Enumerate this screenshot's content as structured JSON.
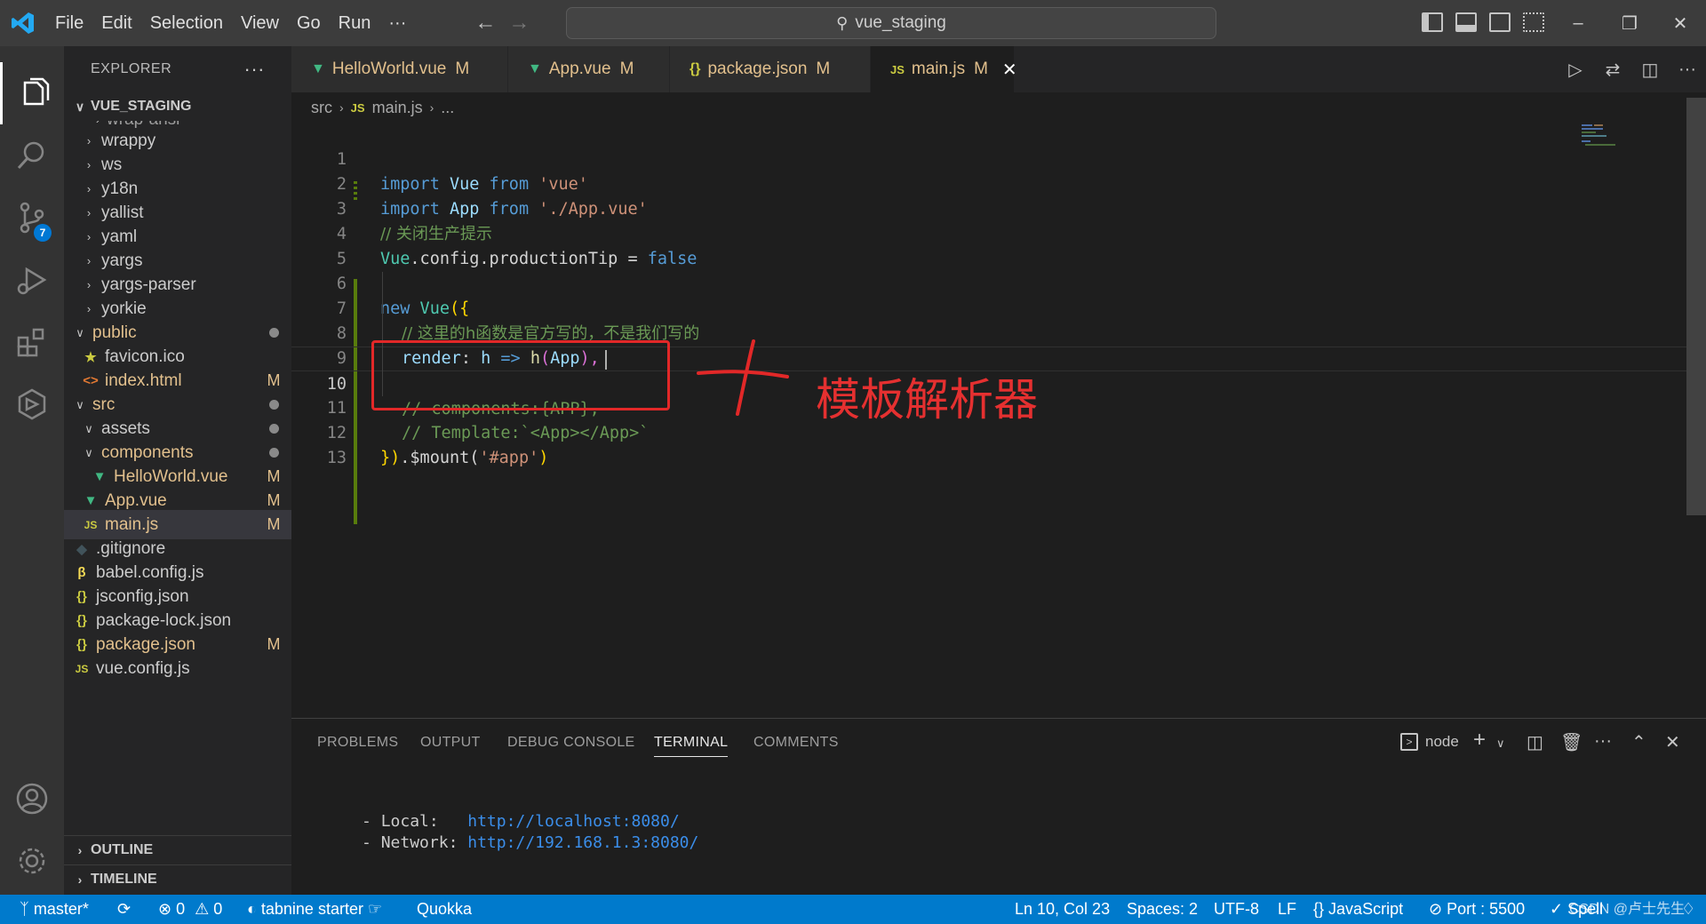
{
  "titlebar": {
    "menu": [
      "File",
      "Edit",
      "Selection",
      "View",
      "Go",
      "Run",
      "···"
    ],
    "search_text": "vue_staging"
  },
  "activity": {
    "scm_badge": "7"
  },
  "explorer": {
    "title": "EXPLORER",
    "more": "···",
    "root": "VUE_STAGING",
    "partial_item": "wrap-ansi",
    "items": [
      {
        "name": "wrappy",
        "kind": "folder"
      },
      {
        "name": "ws",
        "kind": "folder"
      },
      {
        "name": "y18n",
        "kind": "folder"
      },
      {
        "name": "yallist",
        "kind": "folder"
      },
      {
        "name": "yaml",
        "kind": "folder"
      },
      {
        "name": "yargs",
        "kind": "folder"
      },
      {
        "name": "yargs-parser",
        "kind": "folder"
      },
      {
        "name": "yorkie",
        "kind": "folder"
      },
      {
        "name": "public",
        "kind": "folder-open"
      },
      {
        "name": "favicon.ico",
        "kind": "file"
      },
      {
        "name": "index.html",
        "kind": "file",
        "status": "M"
      },
      {
        "name": "src",
        "kind": "folder-open"
      },
      {
        "name": "assets",
        "kind": "folder-open"
      },
      {
        "name": "components",
        "kind": "folder-open"
      },
      {
        "name": "HelloWorld.vue",
        "kind": "file",
        "status": "M"
      },
      {
        "name": "App.vue",
        "kind": "file",
        "status": "M"
      },
      {
        "name": "main.js",
        "kind": "file",
        "status": "M"
      },
      {
        "name": ".gitignore",
        "kind": "file"
      },
      {
        "name": "babel.config.js",
        "kind": "file"
      },
      {
        "name": "jsconfig.json",
        "kind": "file"
      },
      {
        "name": "package-lock.json",
        "kind": "file"
      },
      {
        "name": "package.json",
        "kind": "file",
        "status": "M"
      },
      {
        "name": "vue.config.js",
        "kind": "file"
      }
    ],
    "outline": "OUTLINE",
    "timeline": "TIMELINE"
  },
  "tabs": [
    {
      "label": "HelloWorld.vue",
      "status": "M",
      "icon": "vue-icon"
    },
    {
      "label": "App.vue",
      "status": "M",
      "icon": "vue-icon"
    },
    {
      "label": "package.json",
      "status": "M",
      "icon": "json-icon"
    },
    {
      "label": "main.js",
      "status": "M",
      "icon": "js-icon",
      "active": true
    }
  ],
  "breadcrumb": {
    "folder": "src",
    "file": "main.js",
    "symbol": "..."
  },
  "code": {
    "line_numbers": [
      "1",
      "2",
      "3",
      "4",
      "5",
      "6",
      "7",
      "8",
      "9",
      "10",
      "11",
      "12",
      "13"
    ],
    "l1": {
      "k1": "import",
      "a": " Vue ",
      "k2": "from",
      "s": " 'vue'"
    },
    "l2": {
      "k1": "import",
      "a": " App ",
      "k2": "from",
      "s": " './App.vue'"
    },
    "l3": "// 关闭生产提示",
    "l4": {
      "a": "Vue",
      "b": ".config.productionTip = ",
      "c": "false"
    },
    "l6": {
      "k": "new",
      "a": " Vue",
      "b": "({"
    },
    "l7": "// 这里的h函数是官方写的，不是我们写的",
    "l8": {
      "a": "render",
      "b": ": ",
      "c": "h",
      "d": " => ",
      "e": "h",
      "f": "(",
      "g": "App",
      "h": "),"
    },
    "l10": "// components:{APP},",
    "l11": "// Template:`<App></App>`",
    "l12": {
      "a": "})",
      "b": ".$mount(",
      "c": "'#app'",
      "d": ")"
    }
  },
  "annotation": {
    "text": "模板解析器"
  },
  "panel": {
    "tabs": [
      "PROBLEMS",
      "OUTPUT",
      "DEBUG CONSOLE",
      "TERMINAL",
      "COMMENTS"
    ],
    "active_tab": "TERMINAL",
    "terminal_name": "node",
    "lines": [
      {
        "label": "  - Local:   ",
        "url": "http://localhost:8080/"
      },
      {
        "label": "  - Network: ",
        "url": "http://192.168.1.3:8080/"
      }
    ]
  },
  "status": {
    "branch": "master*",
    "errors": "0",
    "warnings": "0",
    "tabnine": "tabnine starter",
    "quokka": "Quokka",
    "position": "Ln 10, Col 23",
    "spaces": "Spaces: 2",
    "encoding": "UTF-8",
    "eol": "LF",
    "language": "JavaScript",
    "port": "Port : 5500",
    "spell": "Spell",
    "watermark": "CSDN @卢士先生"
  },
  "colors": {
    "accent": "#007acc",
    "annotation": "#e22828",
    "modified": "#e2c08d"
  }
}
